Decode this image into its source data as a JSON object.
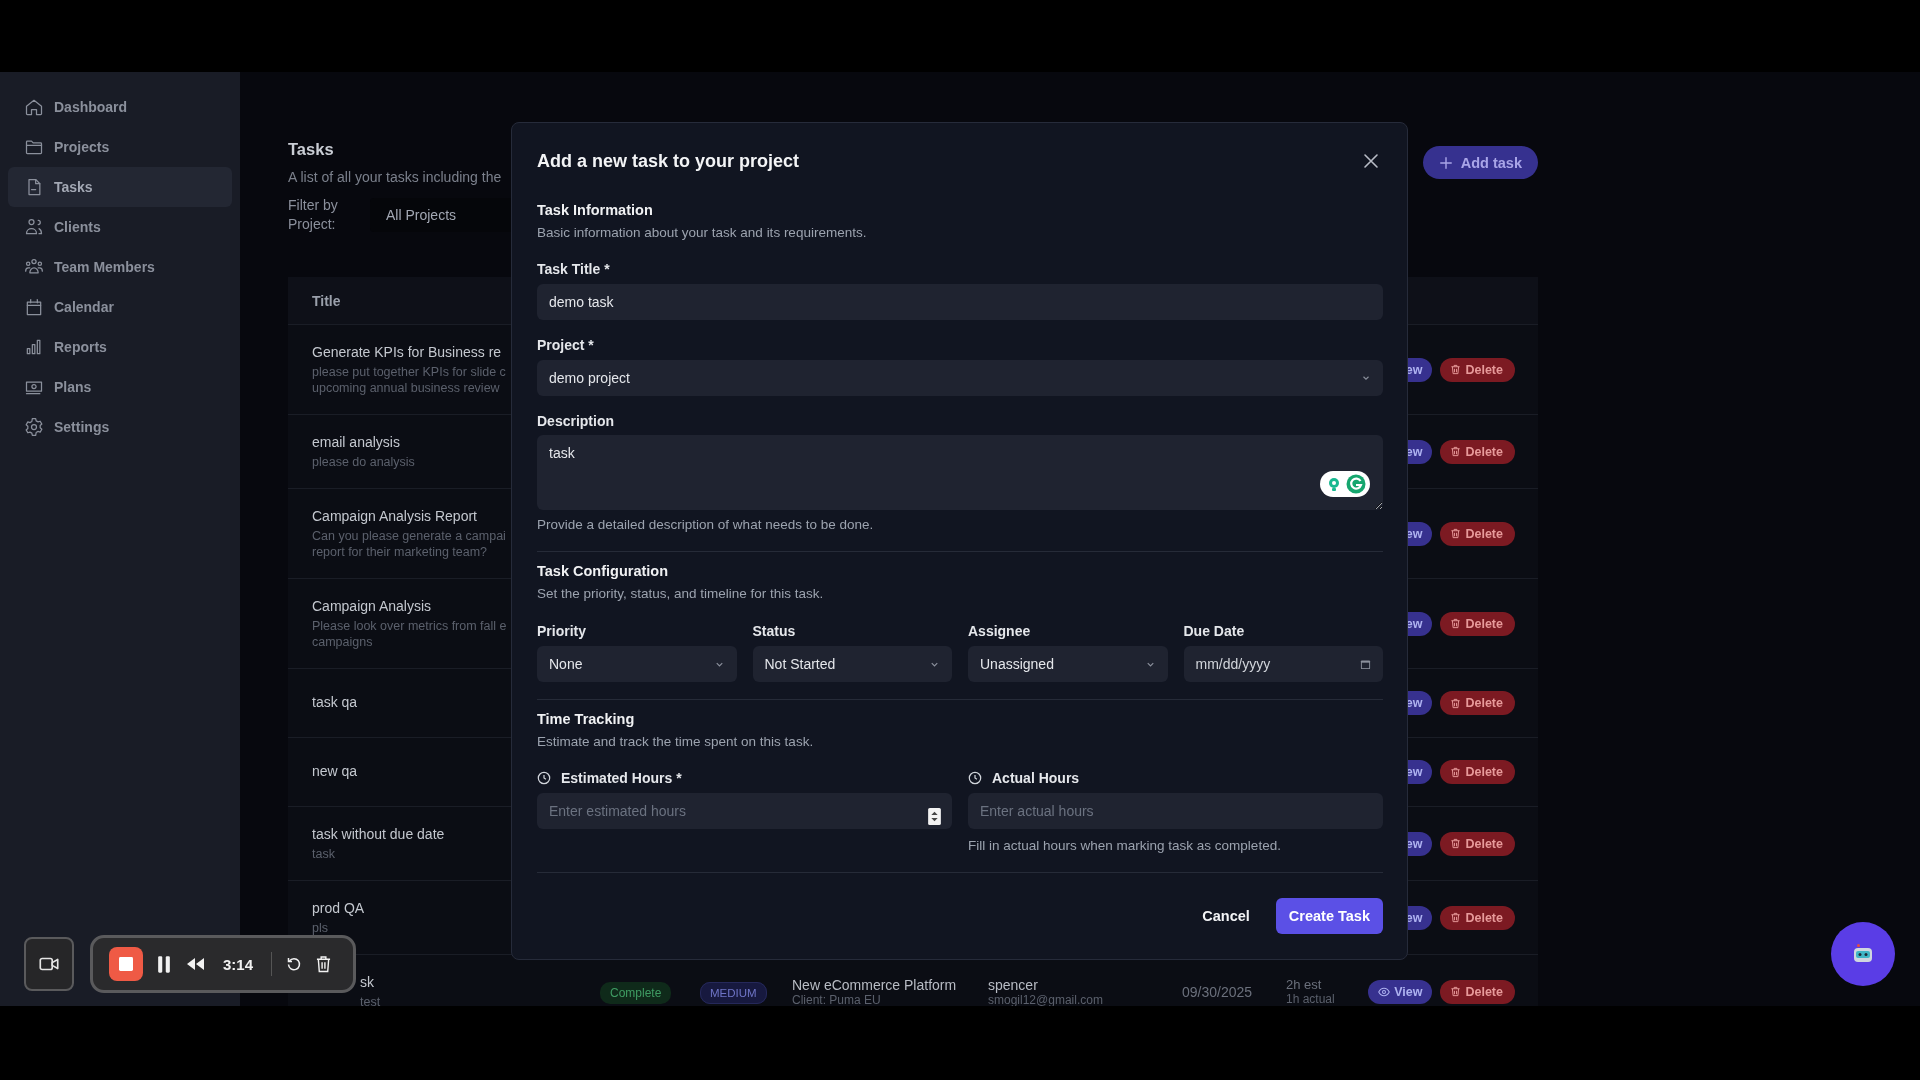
{
  "sidebar": {
    "items": [
      {
        "label": "Dashboard",
        "selected": false
      },
      {
        "label": "Projects",
        "selected": false
      },
      {
        "label": "Tasks",
        "selected": true
      },
      {
        "label": "Clients",
        "selected": false
      },
      {
        "label": "Team Members",
        "selected": false
      },
      {
        "label": "Calendar",
        "selected": false
      },
      {
        "label": "Reports",
        "selected": false
      },
      {
        "label": "Plans",
        "selected": false
      },
      {
        "label": "Settings",
        "selected": false
      }
    ]
  },
  "page": {
    "title": "Tasks",
    "subtitle": "A list of all your tasks including the",
    "filter_label": "Filter by Project:",
    "filter_value": "All Projects",
    "add_button": "Add task"
  },
  "table": {
    "columns": [
      "Title"
    ],
    "rows": [
      {
        "kind": "full",
        "title": "Generate KPIs for Business re",
        "description": [
          "please put together KPIs for slide c",
          "upcoming annual business review"
        ],
        "view": "ew",
        "view_icon": false,
        "delete": "Delete"
      },
      {
        "kind": "full",
        "title": "email analysis",
        "description": [
          "please do analysis"
        ],
        "view": "ew",
        "view_icon": false,
        "delete": "Delete"
      },
      {
        "kind": "full",
        "title": "Campaign Analysis Report",
        "description": [
          "Can you please generate a campai",
          "report for their marketing team?"
        ],
        "view": "ew",
        "view_icon": false,
        "delete": "Delete"
      },
      {
        "kind": "full",
        "title": "Campaign Analysis",
        "description": [
          "Please look over metrics from fall e",
          "campaigns"
        ],
        "view": "ew",
        "view_icon": false,
        "delete": "Delete"
      },
      {
        "kind": "full",
        "title": "task qa",
        "description": [],
        "view": "ew",
        "view_icon": false,
        "delete": "Delete"
      },
      {
        "kind": "full",
        "title": "new qa",
        "description": [],
        "view": "ew",
        "view_icon": false,
        "delete": "Delete"
      },
      {
        "kind": "full",
        "title": "task without due date",
        "description": [
          "task"
        ],
        "view": "ew",
        "view_icon": false,
        "delete": "Delete"
      },
      {
        "kind": "full",
        "title": "prod QA",
        "description": [
          "pls"
        ],
        "view": "ew",
        "view_icon": false,
        "delete": "Delete"
      },
      {
        "kind": "partial",
        "title": "sk",
        "description": [
          "test"
        ],
        "status": "Complete",
        "priority": "MEDIUM",
        "project": "New eCommerce Platform",
        "client": "Client: Puma EU",
        "assignee": "spencer",
        "email": "smogil12@gmail.com",
        "due": "09/30/2025",
        "estimate": "2h est",
        "actual": "1h actual",
        "view": "View",
        "view_icon": true,
        "delete": "Delete"
      }
    ]
  },
  "modal": {
    "title": "Add a new task to your project",
    "info": {
      "heading": "Task Information",
      "description": "Basic information about your task and its requirements.",
      "task_title": {
        "label": "Task Title *",
        "value": "demo task"
      },
      "project": {
        "label": "Project *",
        "value": "demo project"
      },
      "details": {
        "label": "Description",
        "value": "task",
        "help": "Provide a detailed description of what needs to be done."
      }
    },
    "config": {
      "heading": "Task Configuration",
      "description": "Set the priority, status, and timeline for this task.",
      "fields": [
        {
          "kind": "select",
          "label": "Priority",
          "value": "None"
        },
        {
          "kind": "select",
          "label": "Status",
          "value": "Not Started"
        },
        {
          "kind": "select",
          "label": "Assignee",
          "value": "Unassigned"
        },
        {
          "kind": "date",
          "label": "Due Date",
          "value": "mm/dd/yyyy"
        }
      ]
    },
    "time": {
      "heading": "Time Tracking",
      "description": "Estimate and track the time spent on this task.",
      "fields": [
        {
          "label": "Estimated Hours *",
          "placeholder": "Enter estimated hours",
          "spinner": true
        },
        {
          "label": "Actual Hours",
          "placeholder": "Enter actual hours",
          "spinner": false,
          "help": "Fill in actual hours when marking task as completed."
        }
      ]
    },
    "buttons": {
      "cancel": "Cancel",
      "submit": "Create Task"
    }
  },
  "recorder": {
    "time": "3:14"
  }
}
